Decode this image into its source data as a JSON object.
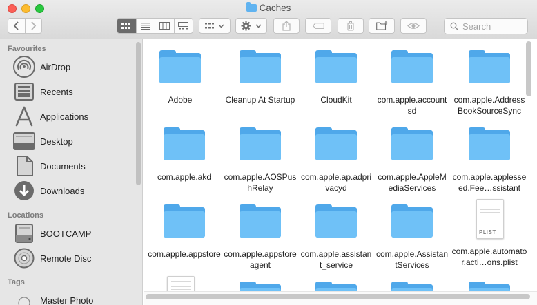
{
  "window": {
    "title": "Caches"
  },
  "toolbar": {
    "back_icon": "chevron-left-icon",
    "forward_icon": "chevron-right-icon",
    "views": [
      "icon-view",
      "list-view",
      "column-view",
      "gallery-view"
    ],
    "active_view": "icon-view",
    "search_placeholder": "Search"
  },
  "sidebar": {
    "favourites_title": "Favourites",
    "favourites": [
      {
        "label": "AirDrop",
        "icon": "airdrop-icon"
      },
      {
        "label": "Recents",
        "icon": "recents-icon"
      },
      {
        "label": "Applications",
        "icon": "applications-icon"
      },
      {
        "label": "Desktop",
        "icon": "desktop-icon"
      },
      {
        "label": "Documents",
        "icon": "documents-icon"
      },
      {
        "label": "Downloads",
        "icon": "downloads-icon"
      }
    ],
    "locations_title": "Locations",
    "locations": [
      {
        "label": "BOOTCAMP",
        "icon": "disk-icon"
      },
      {
        "label": "Remote Disc",
        "icon": "remote-disc-icon"
      }
    ],
    "tags_title": "Tags",
    "tags": [
      {
        "label": "Master Photo",
        "icon": "tag-icon"
      }
    ]
  },
  "files": [
    {
      "name": "Adobe",
      "type": "folder"
    },
    {
      "name": "Cleanup At Startup",
      "type": "folder"
    },
    {
      "name": "CloudKit",
      "type": "folder"
    },
    {
      "name": "com.apple.accountsd",
      "type": "folder"
    },
    {
      "name": "com.apple.AddressBookSourceSync",
      "type": "folder"
    },
    {
      "name": "com.apple.akd",
      "type": "folder"
    },
    {
      "name": "com.apple.AOSPushRelay",
      "type": "folder"
    },
    {
      "name": "com.apple.ap.adprivacyd",
      "type": "folder"
    },
    {
      "name": "com.apple.AppleMediaServices",
      "type": "folder"
    },
    {
      "name": "com.apple.applesseed.Fee…ssistant",
      "type": "folder"
    },
    {
      "name": "com.apple.appstore",
      "type": "folder"
    },
    {
      "name": "com.apple.appstoreagent",
      "type": "folder"
    },
    {
      "name": "com.apple.assistant_service",
      "type": "folder"
    },
    {
      "name": "com.apple.AssistantServices",
      "type": "folder"
    },
    {
      "name": "com.apple.automator.acti…ons.plist",
      "type": "plist",
      "badge": "PLIST"
    }
  ]
}
